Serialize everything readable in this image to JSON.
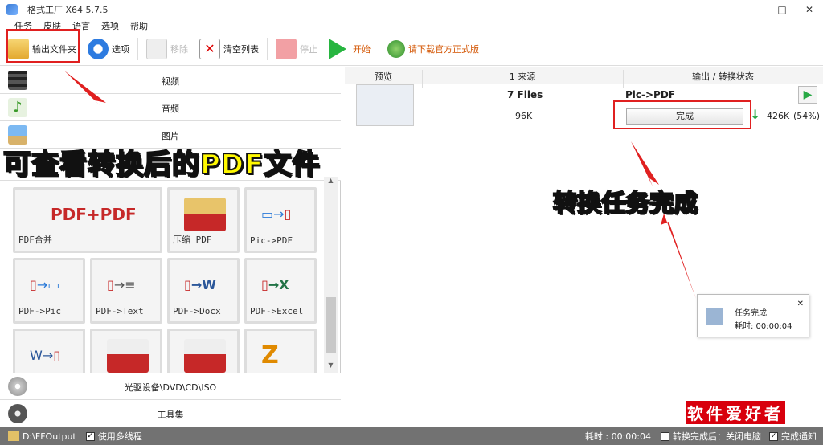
{
  "window": {
    "title": "格式工厂 X64 5.7.5",
    "minimize": "–",
    "maximize": "□",
    "close": "✕"
  },
  "menu": [
    "任务",
    "皮肤",
    "语言",
    "选项",
    "帮助"
  ],
  "toolbar": {
    "output_folder": "输出文件夹",
    "options": "选项",
    "remove": "移除",
    "clear_list": "清空列表",
    "stop": "停止",
    "start": "开始",
    "download": "请下载官方正式版"
  },
  "categories": {
    "video": "视频",
    "audio": "音频",
    "image": "图片",
    "optical": "光驱设备\\DVD\\CD\\ISO",
    "toolbox": "工具集"
  },
  "annotations": {
    "left_overlay": "可查看转换后的PDF文件",
    "right_overlay": "转换任务完成"
  },
  "tiles": [
    {
      "label": "PDF合并"
    },
    {
      "label": "压缩 PDF"
    },
    {
      "label": "Pic->PDF"
    },
    {
      "label": "PDF->Pic"
    },
    {
      "label": "PDF->Text"
    },
    {
      "label": "PDF->Docx"
    },
    {
      "label": "PDF->Excel"
    },
    {
      "label": ""
    },
    {
      "label": ""
    },
    {
      "label": ""
    },
    {
      "label": ""
    }
  ],
  "table": {
    "headers": {
      "preview": "预览",
      "source": "1 来源",
      "output": "输出 / 转换状态"
    },
    "row": {
      "files": "7 Files",
      "source_size": "96K",
      "conversion": "Pic->PDF",
      "status": "完成",
      "output_size": "426K",
      "ratio": "(54%)"
    }
  },
  "toast": {
    "title": "任务完成",
    "time": "耗时: 00:00:04",
    "close": "✕"
  },
  "watermark": "软件爱好者",
  "status": {
    "path": "D:\\FFOutput",
    "multithread": "使用多线程",
    "elapsed": "耗时 : 00:00:04",
    "after_convert": "转换完成后：关闭电脑",
    "notify": "完成通知"
  },
  "colors": {
    "highlight": "#e02020",
    "overlay_text": "#fff800",
    "status_bg": "#727272"
  }
}
